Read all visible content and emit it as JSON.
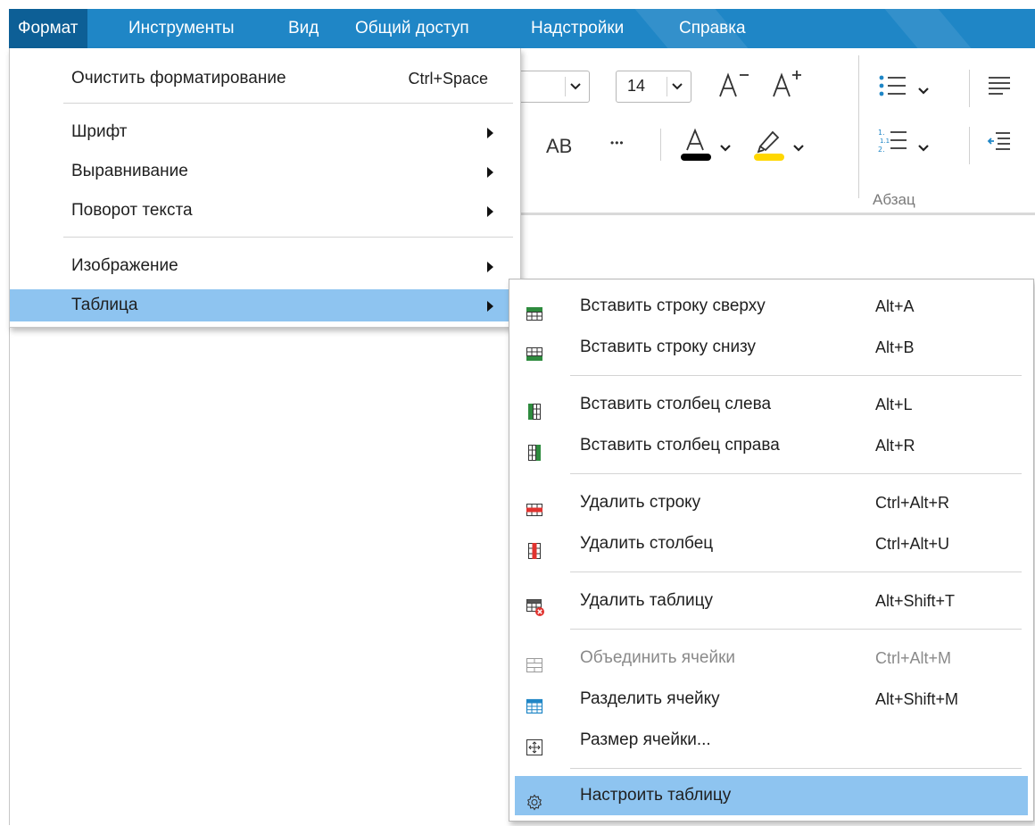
{
  "menubar": {
    "items": [
      "Формат",
      "Инструменты",
      "Вид",
      "Общий доступ",
      "Надстройки",
      "Справка"
    ],
    "accent": "#1f86c6",
    "active_bg": "#0d5f96"
  },
  "toolbar": {
    "font_size": "14",
    "caps_label": "AB",
    "more_label": "•••",
    "paragraph_group": "Абзац",
    "icons": [
      "decrease-font-icon",
      "increase-font-icon",
      "font-color-icon",
      "highlight-icon",
      "bullet-list-icon",
      "numbered-list-icon",
      "align-left-icon",
      "decrease-indent-icon"
    ]
  },
  "format_menu": {
    "clear": {
      "label": "Очистить форматирование",
      "shortcut": "Ctrl+Space"
    },
    "font": "Шрифт",
    "align": "Выравнивание",
    "rotate": "Поворот текста",
    "image": "Изображение",
    "table": "Таблица"
  },
  "table_menu": {
    "ins_row_above": {
      "label": "Вставить строку сверху",
      "shortcut": "Alt+A"
    },
    "ins_row_below": {
      "label": "Вставить строку снизу",
      "shortcut": "Alt+B"
    },
    "ins_col_left": {
      "label": "Вставить столбец слева",
      "shortcut": "Alt+L"
    },
    "ins_col_right": {
      "label": "Вставить столбец справа",
      "shortcut": "Alt+R"
    },
    "del_row": {
      "label": "Удалить строку",
      "shortcut": "Ctrl+Alt+R"
    },
    "del_col": {
      "label": "Удалить столбец",
      "shortcut": "Ctrl+Alt+U"
    },
    "del_table": {
      "label": "Удалить таблицу",
      "shortcut": "Alt+Shift+T"
    },
    "merge": {
      "label": "Объединить ячейки",
      "shortcut": "Ctrl+Alt+M"
    },
    "split": {
      "label": "Разделить ячейку",
      "shortcut": "Alt+Shift+M"
    },
    "cell_size": {
      "label": "Размер ячейки..."
    },
    "settings": {
      "label": "Настроить таблицу"
    }
  },
  "colors": {
    "highlight": "#8ec4f0",
    "font_color_bar": "#000000",
    "highlight_color_bar": "#ffd700",
    "insert_green": "#2e8b3e",
    "delete_red": "#e0332f",
    "split_blue": "#1f86c6"
  }
}
